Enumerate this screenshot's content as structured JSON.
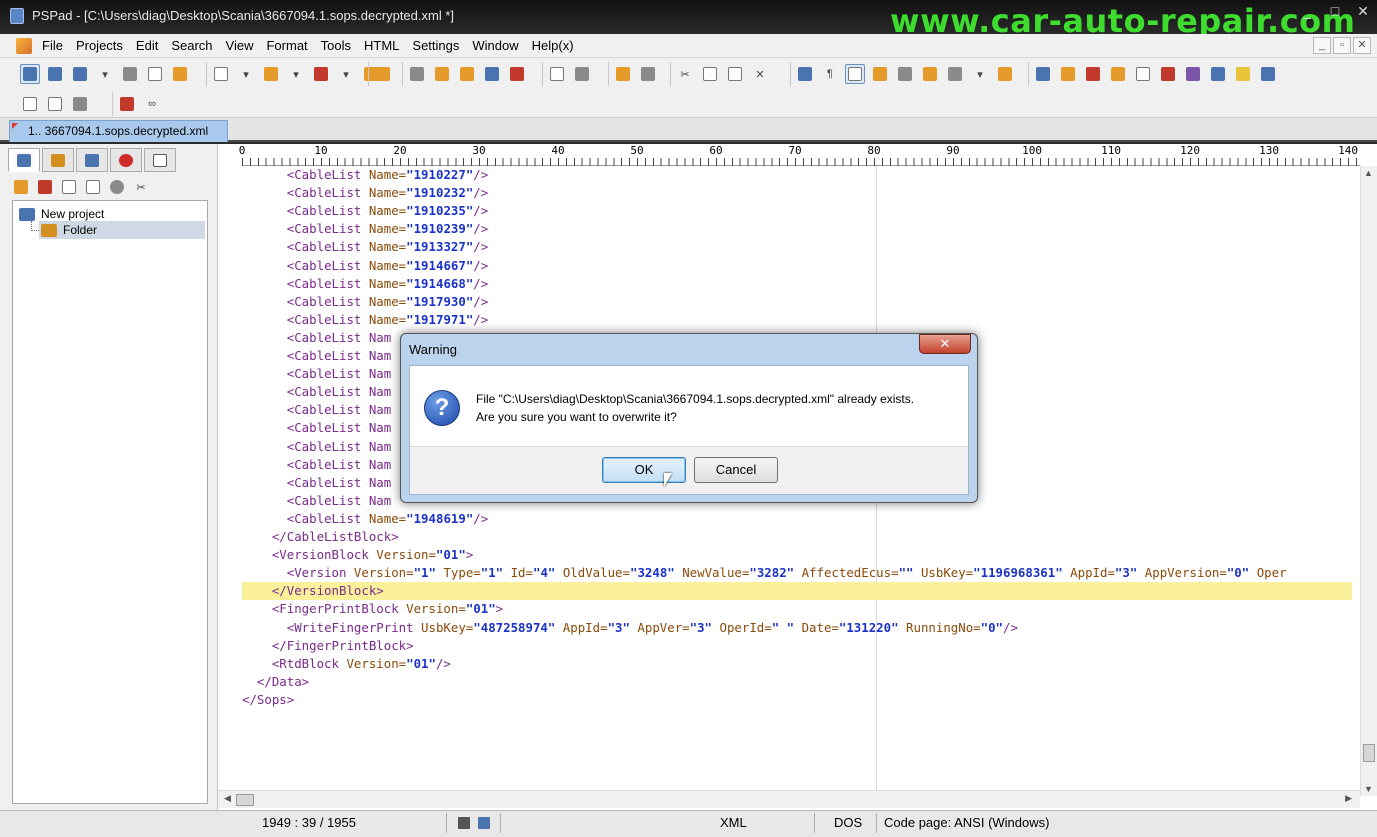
{
  "window": {
    "title": "PSPad - [C:\\Users\\diag\\Desktop\\Scania\\3667094.1.sops.decrypted.xml *]",
    "watermark": "www.car-auto-repair.com",
    "controls": [
      "_",
      "□",
      "✕"
    ]
  },
  "menu": {
    "items": [
      "File",
      "Projects",
      "Edit",
      "Search",
      "View",
      "Format",
      "Tools",
      "HTML",
      "Settings",
      "Window",
      "Help(x)"
    ],
    "mdi_controls": [
      "_",
      "▫",
      "✕"
    ]
  },
  "tabs": [
    {
      "label": "1.. 3667094.1.sops.decrypted.xml"
    }
  ],
  "project_tree": {
    "root": "New project",
    "folder": "Folder"
  },
  "ruler": {
    "ticks": [
      "0",
      "10",
      "20",
      "30",
      "40",
      "50",
      "60",
      "70",
      "80",
      "90",
      "100",
      "110",
      "120",
      "130",
      "140"
    ]
  },
  "code_lines": [
    {
      "indent": 3,
      "tag": "CableList",
      "attrs": [
        [
          "Name",
          "1910227"
        ]
      ],
      "self": true
    },
    {
      "indent": 3,
      "tag": "CableList",
      "attrs": [
        [
          "Name",
          "1910232"
        ]
      ],
      "self": true
    },
    {
      "indent": 3,
      "tag": "CableList",
      "attrs": [
        [
          "Name",
          "1910235"
        ]
      ],
      "self": true
    },
    {
      "indent": 3,
      "tag": "CableList",
      "attrs": [
        [
          "Name",
          "1910239"
        ]
      ],
      "self": true
    },
    {
      "indent": 3,
      "tag": "CableList",
      "attrs": [
        [
          "Name",
          "1913327"
        ]
      ],
      "self": true
    },
    {
      "indent": 3,
      "tag": "CableList",
      "attrs": [
        [
          "Name",
          "1914667"
        ]
      ],
      "self": true
    },
    {
      "indent": 3,
      "tag": "CableList",
      "attrs": [
        [
          "Name",
          "1914668"
        ]
      ],
      "self": true
    },
    {
      "indent": 3,
      "tag": "CableList",
      "attrs": [
        [
          "Name",
          "1917930"
        ]
      ],
      "self": true
    },
    {
      "indent": 3,
      "tag": "CableList",
      "attrs": [
        [
          "Name",
          "1917971"
        ]
      ],
      "self": true
    },
    {
      "indent": 3,
      "raw": "<CableList Nam"
    },
    {
      "indent": 3,
      "raw": "<CableList Nam"
    },
    {
      "indent": 3,
      "raw": "<CableList Nam"
    },
    {
      "indent": 3,
      "raw": "<CableList Nam"
    },
    {
      "indent": 3,
      "raw": "<CableList Nam"
    },
    {
      "indent": 3,
      "raw": "<CableList Nam"
    },
    {
      "indent": 3,
      "raw": "<CableList Nam"
    },
    {
      "indent": 3,
      "raw": "<CableList Nam"
    },
    {
      "indent": 3,
      "raw": "<CableList Nam"
    },
    {
      "indent": 3,
      "raw": "<CableList Nam"
    },
    {
      "indent": 3,
      "tag": "CableList",
      "attrs": [
        [
          "Name",
          "1948619"
        ]
      ],
      "self": true
    },
    {
      "indent": 2,
      "close": "CableListBlock"
    },
    {
      "indent": 2,
      "tag": "VersionBlock",
      "attrs": [
        [
          "Version",
          "01"
        ]
      ],
      "self": false
    },
    {
      "indent": 3,
      "tag": "Version",
      "attrs": [
        [
          "Version",
          "1"
        ],
        [
          "Type",
          "1"
        ],
        [
          "Id",
          "4"
        ],
        [
          "OldValue",
          "3248"
        ],
        [
          "NewValue",
          "3282"
        ],
        [
          "AffectedEcus",
          ""
        ],
        [
          "UsbKey",
          "1196968361"
        ],
        [
          "AppId",
          "3"
        ],
        [
          "AppVersion",
          "0"
        ]
      ],
      "self": false,
      "tail": " Oper"
    },
    {
      "indent": 2,
      "close": "VersionBlock",
      "highlight": true
    },
    {
      "indent": 2,
      "tag": "FingerPrintBlock",
      "attrs": [
        [
          "Version",
          "01"
        ]
      ],
      "self": false
    },
    {
      "indent": 3,
      "tag": "WriteFingerPrint",
      "attrs": [
        [
          "UsbKey",
          "487258974"
        ],
        [
          "AppId",
          "3"
        ],
        [
          "AppVer",
          "3"
        ],
        [
          "OperId",
          " "
        ],
        [
          "Date",
          "131220"
        ],
        [
          "RunningNo",
          "0"
        ]
      ],
      "self": true
    },
    {
      "indent": 2,
      "close": "FingerPrintBlock"
    },
    {
      "indent": 2,
      "tag": "RtdBlock",
      "attrs": [
        [
          "Version",
          "01"
        ]
      ],
      "self": true
    },
    {
      "indent": 1,
      "close": "Data"
    },
    {
      "indent": 0,
      "close": "Sops"
    }
  ],
  "status": {
    "position": "1949 : 39 / 1955",
    "syntax": "XML",
    "line_endings": "DOS",
    "code_page": "Code page: ANSI (Windows)"
  },
  "dialog": {
    "title": "Warning",
    "close": "✕",
    "icon": "question-icon",
    "icon_glyph": "?",
    "message_line1": "File \"C:\\Users\\diag\\Desktop\\Scania\\3667094.1.sops.decrypted.xml\" already exists.",
    "message_line2": "Are you sure you want to overwrite it?",
    "ok_label": "OK",
    "cancel_label": "Cancel"
  },
  "colors": {
    "tag": "#7a2a8a",
    "attr": "#8a4a0a",
    "value": "#1a32c8",
    "highlight_line": "#fbf19a",
    "watermark": "#3ddc2e"
  }
}
